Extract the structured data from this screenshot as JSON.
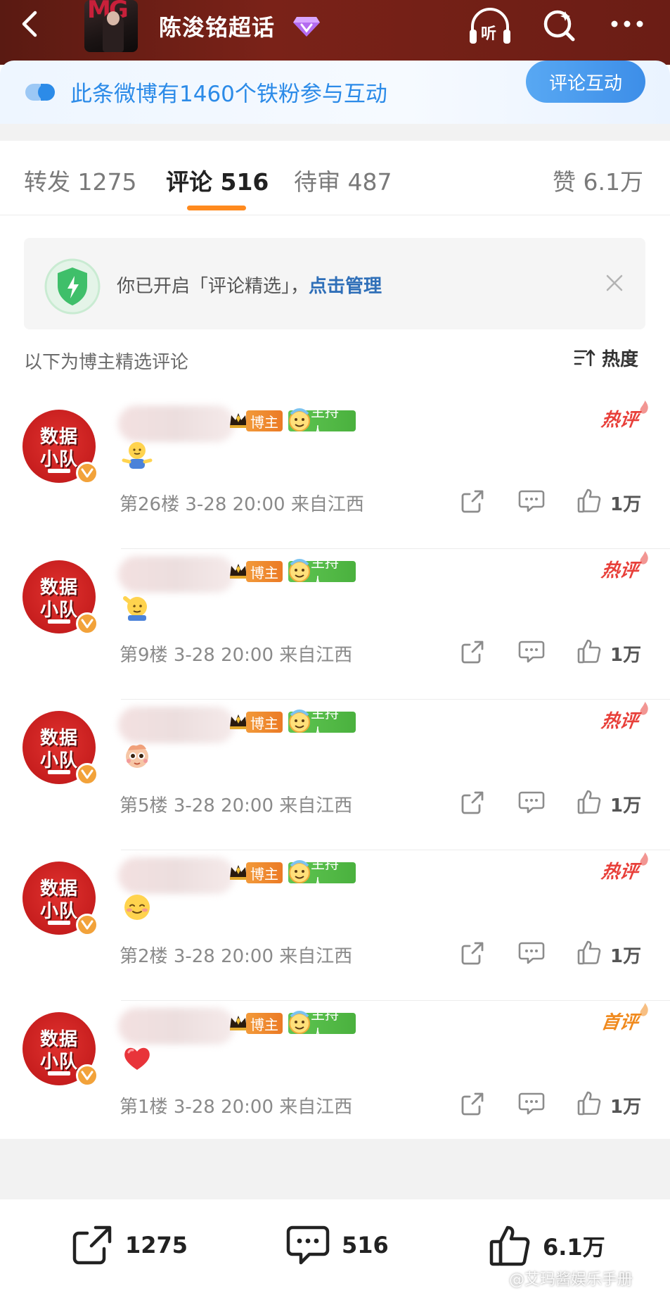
{
  "header": {
    "topic_title": "陈浚铭超话",
    "listen_label": "听"
  },
  "banner": {
    "text": "此条微博有1460个铁粉参与互动",
    "button_label": "评论互动"
  },
  "tabs": [
    {
      "label": "转发 1275"
    },
    {
      "label": "评论 516"
    },
    {
      "label": "待审 487"
    },
    {
      "label": "赞 6.1万"
    }
  ],
  "notice": {
    "text_prefix": "你已开启「评论精选」，",
    "link": "点击管理"
  },
  "section": {
    "label": "以下为博主精选评论",
    "sort_label": "热度"
  },
  "avatar_text": {
    "line1": "数据",
    "line2": "小队"
  },
  "badges": {
    "host": "博主",
    "moderator": "主持人"
  },
  "comments": [
    {
      "tag": "热评",
      "floor": "第26楼",
      "time": "3-28 20:00",
      "location": "来自江西",
      "likes": "1万",
      "emoji": "shrug-emoji"
    },
    {
      "tag": "热评",
      "floor": "第9楼",
      "time": "3-28 20:00",
      "location": "来自江西",
      "likes": "1万",
      "emoji": "salute-emoji"
    },
    {
      "tag": "热评",
      "floor": "第5楼",
      "time": "3-28 20:00",
      "location": "来自江西",
      "likes": "1万",
      "emoji": "cute-character-emoji"
    },
    {
      "tag": "热评",
      "floor": "第2楼",
      "time": "3-28 20:00",
      "location": "来自江西",
      "likes": "1万",
      "emoji": "shy-smile-emoji"
    },
    {
      "tag": "首评",
      "floor": "第1楼",
      "time": "3-28 20:00",
      "location": "来自江西",
      "likes": "1万",
      "emoji": "heart-emoji"
    }
  ],
  "bottom_bar": {
    "reposts": "1275",
    "comments": "516",
    "likes": "6.1万"
  },
  "watermark": "@艾玛酱娱乐手册",
  "colors": {
    "accent_orange": "#ff8a1e",
    "hot_red": "#e8403a",
    "first_orange": "#f08a1e",
    "link_blue": "#2f6fb8",
    "banner_blue": "#2c8be8"
  }
}
